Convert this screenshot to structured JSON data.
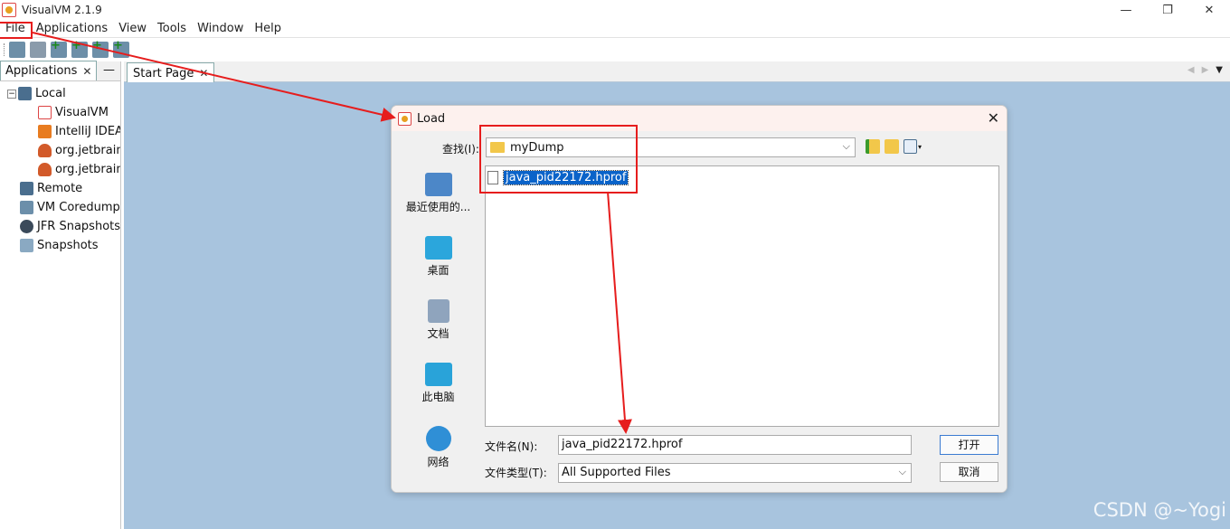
{
  "window": {
    "title": "VisualVM 2.1.9",
    "controls": [
      "—",
      "❐",
      "✕"
    ]
  },
  "menu": [
    "File",
    "Applications",
    "View",
    "Tools",
    "Window",
    "Help"
  ],
  "left_panel": {
    "tab_label": "Applications",
    "tab_close": "✕",
    "minimize": "—",
    "tree": {
      "local": "Local",
      "local_toggle": "−",
      "children": [
        "VisualVM",
        "IntelliJ IDEA",
        "org.jetbrains",
        "org.jetbrains"
      ],
      "remote": "Remote",
      "coredumps": "VM Coredumps",
      "jfr": "JFR Snapshots",
      "snapshots": "Snapshots"
    }
  },
  "main": {
    "tab_label": "Start Page",
    "tab_close": "✕",
    "nav_prev": "◀",
    "nav_next": "▶",
    "nav_menu": "▼"
  },
  "dialog": {
    "title": "Load",
    "close": "✕",
    "look_in_label": "查找(I):",
    "look_in_value": "myDump",
    "places": [
      "最近使用的...",
      "桌面",
      "文档",
      "此电脑",
      "网络"
    ],
    "files": [
      "java_pid22172.hprof"
    ],
    "file_name_label": "文件名(N):",
    "file_name_value": "java_pid22172.hprof",
    "file_type_label": "文件类型(T):",
    "file_type_value": "All Supported Files",
    "open_button": "打开",
    "cancel_button": "取消",
    "dropdown_arrow": "⌵",
    "view_dropdown": "▾"
  },
  "watermark": "CSDN @~Yogi",
  "colors": {
    "main_background": "#a8c4de",
    "selection": "#0a63c9",
    "annotation": "#e61d1d"
  }
}
